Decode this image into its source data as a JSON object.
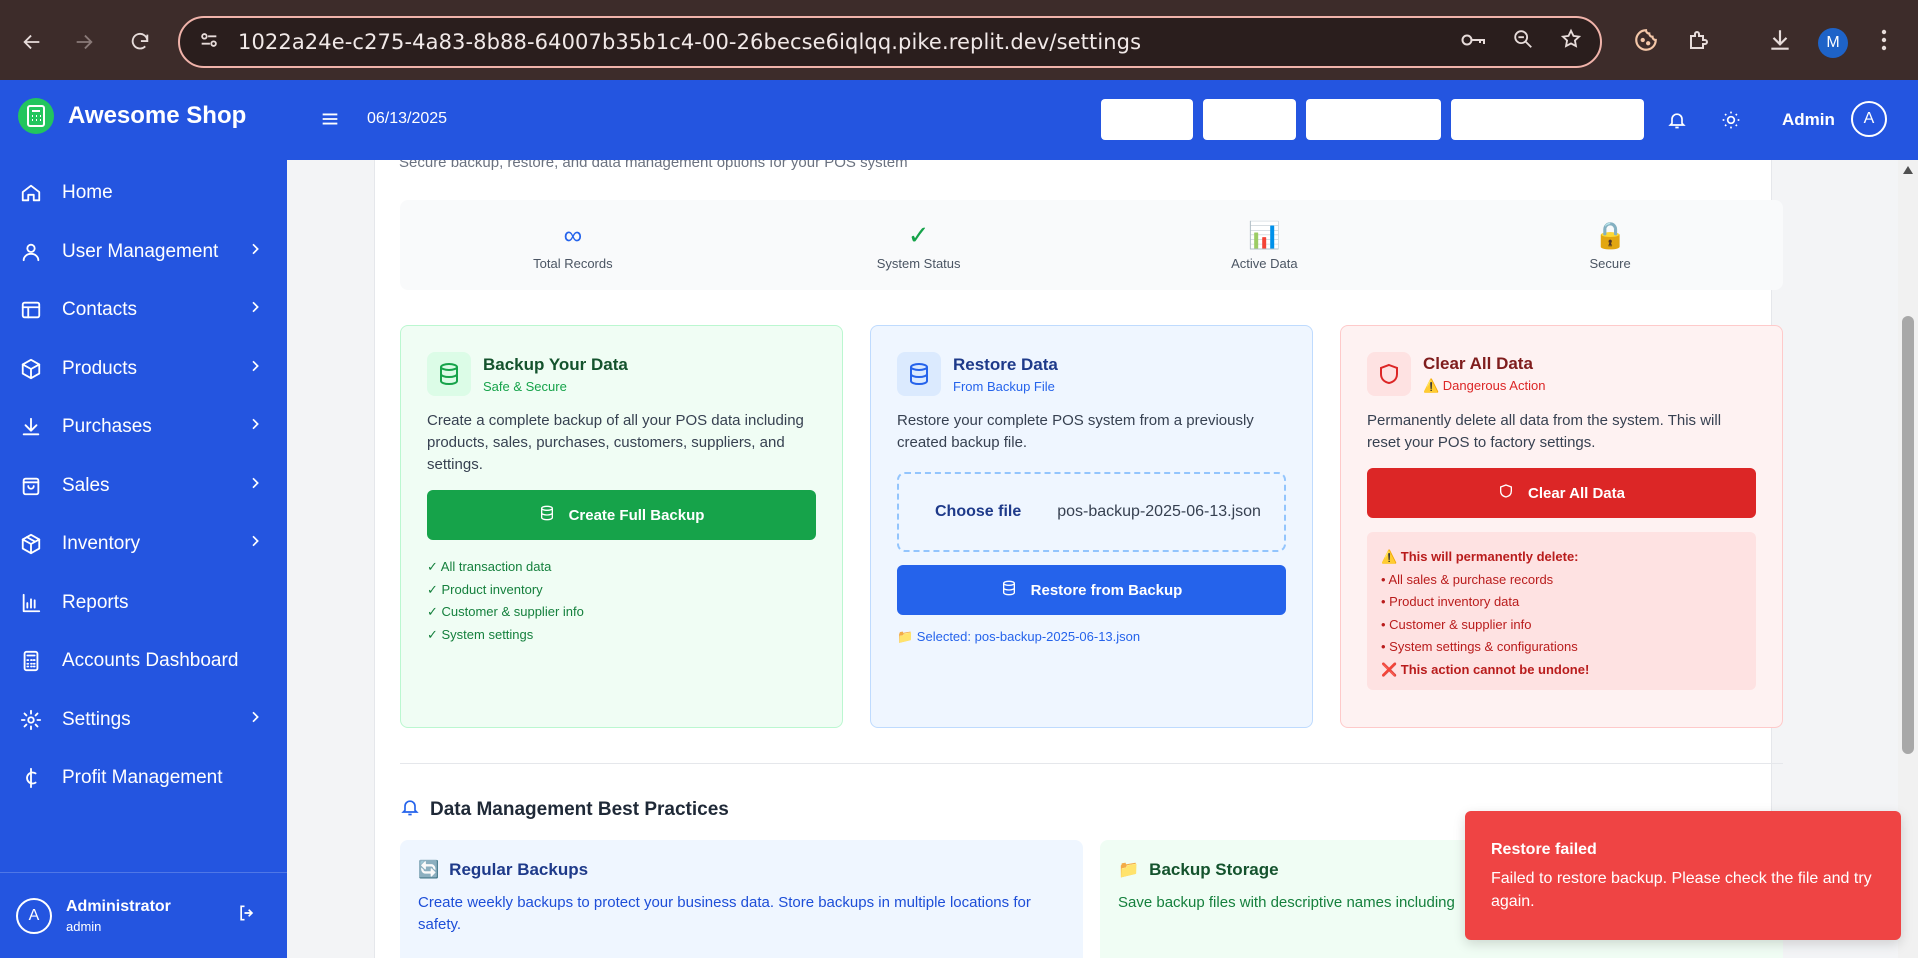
{
  "browser": {
    "url": "1022a24e-c275-4a83-8b88-64007b35b1c4-00-26becse6iqlqq.pike.replit.dev/settings",
    "profile_initial": "M"
  },
  "sidebar": {
    "brand": "Awesome Shop",
    "items": [
      {
        "label": "Home",
        "icon": "home-icon",
        "has_chevron": false
      },
      {
        "label": "User Management",
        "icon": "user-icon",
        "has_chevron": true
      },
      {
        "label": "Contacts",
        "icon": "contacts-icon",
        "has_chevron": true
      },
      {
        "label": "Products",
        "icon": "box-icon",
        "has_chevron": true
      },
      {
        "label": "Purchases",
        "icon": "download-icon",
        "has_chevron": true
      },
      {
        "label": "Sales",
        "icon": "shopping-bag-icon",
        "has_chevron": true
      },
      {
        "label": "Inventory",
        "icon": "package-icon",
        "has_chevron": true
      },
      {
        "label": "Reports",
        "icon": "bar-chart-icon",
        "has_chevron": false
      },
      {
        "label": "Accounts Dashboard",
        "icon": "calculator-icon",
        "has_chevron": false
      },
      {
        "label": "Settings",
        "icon": "gear-icon",
        "has_chevron": true
      },
      {
        "label": "Profit Management",
        "icon": "cedi-icon",
        "has_chevron": false
      }
    ],
    "user": {
      "initial": "A",
      "name": "Administrator",
      "role": "admin"
    }
  },
  "header": {
    "date": "06/13/2025",
    "admin_label": "Admin",
    "admin_initial": "A"
  },
  "page": {
    "subtitle": "Secure backup, restore, and data management options for your POS system",
    "stats": [
      {
        "icon": "∞",
        "label": "Total Records",
        "color": "#2563eb"
      },
      {
        "icon": "✓",
        "label": "System Status",
        "color": "#16a34a"
      },
      {
        "icon": "📊",
        "label": "Active Data",
        "color": "#6b7280"
      },
      {
        "icon": "🔒",
        "label": "Secure",
        "color": "#eab308"
      }
    ],
    "backup": {
      "title": "Backup Your Data",
      "subtitle": "Safe & Secure",
      "description": "Create a complete backup of all your POS data including products, sales, purchases, customers, suppliers, and settings.",
      "button": "Create Full Backup",
      "checks": [
        "✓ All transaction data",
        "✓ Product inventory",
        "✓ Customer & supplier info",
        "✓ System settings"
      ]
    },
    "restore": {
      "title": "Restore Data",
      "subtitle": "From Backup File",
      "description": "Restore your complete POS system from a previously created backup file.",
      "choose_file": "Choose file",
      "file_name": "pos-backup-2025-06-13.json",
      "button": "Restore from Backup",
      "selected": "📁 Selected: pos-backup-2025-06-13.json"
    },
    "clear": {
      "title": "Clear All Data",
      "subtitle": "⚠️ Dangerous Action",
      "description": "Permanently delete all data from the system. This will reset your POS to factory settings.",
      "button": "Clear All Data",
      "warning_title": "⚠️ This will permanently delete:",
      "warning_items": [
        "• All sales & purchase records",
        "• Product inventory data",
        "• Customer & supplier info",
        "• System settings & configurations"
      ],
      "warning_footer": "❌ This action cannot be undone!"
    },
    "best_practices": {
      "title": "Data Management Best Practices",
      "cards": [
        {
          "icon": "🔄",
          "title": "Regular Backups",
          "description": "Create weekly backups to protect your business data. Store backups in multiple locations for safety."
        },
        {
          "icon": "📁",
          "title": "Backup Storage",
          "description": "Save backup files with descriptive names including"
        }
      ]
    }
  },
  "toast": {
    "title": "Restore failed",
    "message": "Failed to restore backup. Please check the file and try again."
  }
}
